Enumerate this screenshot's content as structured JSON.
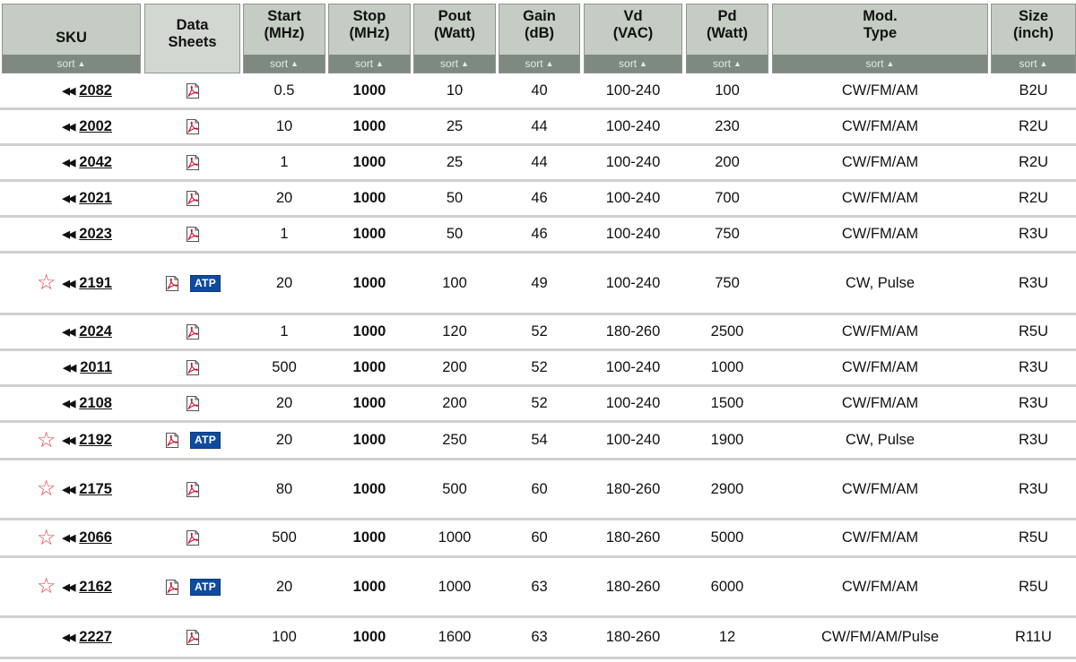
{
  "columns": [
    {
      "label1": "SKU",
      "label2": "",
      "sort": "sort"
    },
    {
      "label1": "Data",
      "label2": "Sheets",
      "sort": ""
    },
    {
      "label1": "Start",
      "label2": "(MHz)",
      "sort": "sort"
    },
    {
      "label1": "Stop",
      "label2": "(MHz)",
      "sort": "sort"
    },
    {
      "label1": "Pout",
      "label2": "(Watt)",
      "sort": "sort"
    },
    {
      "label1": "Gain",
      "label2": "(dB)",
      "sort": "sort"
    },
    {
      "label1": "Vd",
      "label2": "(VAC)",
      "sort": "sort"
    },
    {
      "label1": "Pd",
      "label2": "(Watt)",
      "sort": "sort"
    },
    {
      "label1": "Mod.",
      "label2": "Type",
      "sort": "sort"
    },
    {
      "label1": "Size",
      "label2": "(inch)",
      "sort": "sort"
    }
  ],
  "sort_arrow": "▲",
  "rows_arrow": "◀◀",
  "star_glyph": "☆",
  "atp_label": "ATP",
  "rows": [
    {
      "sku": "2082",
      "star": false,
      "atp": false,
      "start": "0.5",
      "stop": "1000",
      "pout": "10",
      "gain": "40",
      "vd": "100-240",
      "pd": "100",
      "mod": "CW/FM/AM",
      "size": "B2U"
    },
    {
      "sku": "2002",
      "star": false,
      "atp": false,
      "start": "10",
      "stop": "1000",
      "pout": "25",
      "gain": "44",
      "vd": "100-240",
      "pd": "230",
      "mod": "CW/FM/AM",
      "size": "R2U"
    },
    {
      "sku": "2042",
      "star": false,
      "atp": false,
      "start": "1",
      "stop": "1000",
      "pout": "25",
      "gain": "44",
      "vd": "100-240",
      "pd": "200",
      "mod": "CW/FM/AM",
      "size": "R2U"
    },
    {
      "sku": "2021",
      "star": false,
      "atp": false,
      "start": "20",
      "stop": "1000",
      "pout": "50",
      "gain": "46",
      "vd": "100-240",
      "pd": "700",
      "mod": "CW/FM/AM",
      "size": "R2U"
    },
    {
      "sku": "2023",
      "star": false,
      "atp": false,
      "start": "1",
      "stop": "1000",
      "pout": "50",
      "gain": "46",
      "vd": "100-240",
      "pd": "750",
      "mod": "CW/FM/AM",
      "size": "R3U"
    },
    {
      "sku": "2191",
      "star": true,
      "atp": true,
      "start": "20",
      "stop": "1000",
      "pout": "100",
      "gain": "49",
      "vd": "100-240",
      "pd": "750",
      "mod": "CW, Pulse",
      "size": "R3U"
    },
    {
      "sku": "2024",
      "star": false,
      "atp": false,
      "start": "1",
      "stop": "1000",
      "pout": "120",
      "gain": "52",
      "vd": "180-260",
      "pd": "2500",
      "mod": "CW/FM/AM",
      "size": "R5U"
    },
    {
      "sku": "2011",
      "star": false,
      "atp": false,
      "start": "500",
      "stop": "1000",
      "pout": "200",
      "gain": "52",
      "vd": "100-240",
      "pd": "1000",
      "mod": "CW/FM/AM",
      "size": "R3U"
    },
    {
      "sku": "2108",
      "star": false,
      "atp": false,
      "start": "20",
      "stop": "1000",
      "pout": "200",
      "gain": "52",
      "vd": "100-240",
      "pd": "1500",
      "mod": "CW/FM/AM",
      "size": "R3U"
    },
    {
      "sku": "2192",
      "star": true,
      "atp": true,
      "start": "20",
      "stop": "1000",
      "pout": "250",
      "gain": "54",
      "vd": "100-240",
      "pd": "1900",
      "mod": "CW, Pulse",
      "size": "R3U"
    },
    {
      "sku": "2175",
      "star": true,
      "atp": false,
      "start": "80",
      "stop": "1000",
      "pout": "500",
      "gain": "60",
      "vd": "180-260",
      "pd": "2900",
      "mod": "CW/FM/AM",
      "size": "R3U"
    },
    {
      "sku": "2066",
      "star": true,
      "atp": false,
      "start": "500",
      "stop": "1000",
      "pout": "1000",
      "gain": "60",
      "vd": "180-260",
      "pd": "5000",
      "mod": "CW/FM/AM",
      "size": "R5U"
    },
    {
      "sku": "2162",
      "star": true,
      "atp": true,
      "start": "20",
      "stop": "1000",
      "pout": "1000",
      "gain": "63",
      "vd": "180-260",
      "pd": "6000",
      "mod": "CW/FM/AM",
      "size": "R5U"
    },
    {
      "sku": "2227",
      "star": false,
      "atp": false,
      "start": "100",
      "stop": "1000",
      "pout": "1600",
      "gain": "63",
      "vd": "180-260",
      "pd": "12",
      "mod": "CW/FM/AM/Pulse",
      "size": "R11U"
    }
  ]
}
